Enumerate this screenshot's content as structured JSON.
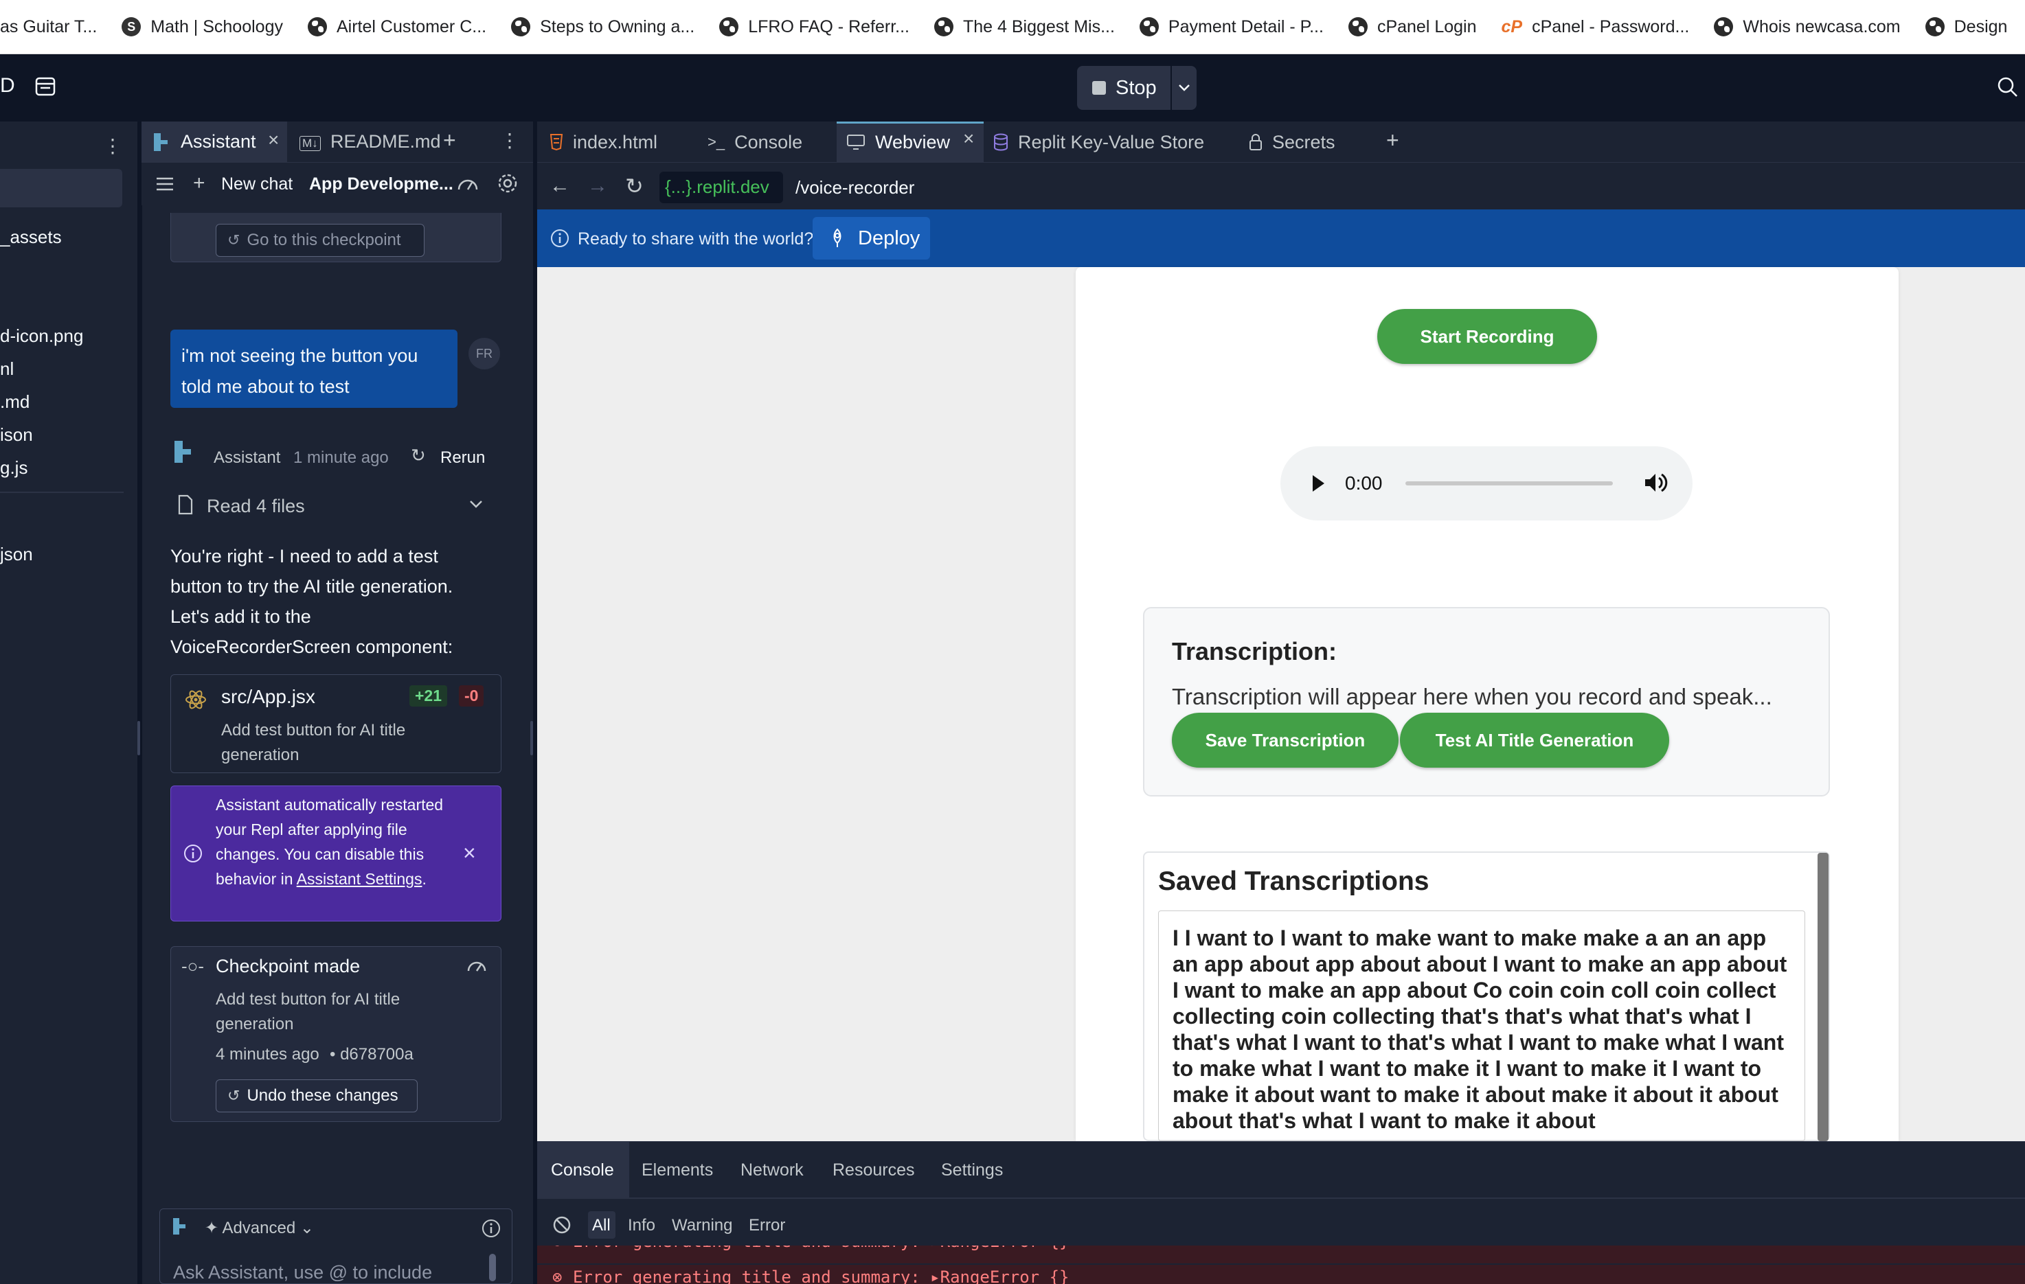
{
  "bookmarks": [
    {
      "label": "as Guitar T...",
      "icon": "globe-icon"
    },
    {
      "label": "Math | Schoology",
      "icon": "schoology-icon"
    },
    {
      "label": "Airtel Customer C...",
      "icon": "globe-icon"
    },
    {
      "label": "Steps to Owning a...",
      "icon": "globe-icon"
    },
    {
      "label": "LFRO FAQ - Referr...",
      "icon": "globe-icon"
    },
    {
      "label": "The 4 Biggest Mis...",
      "icon": "globe-icon"
    },
    {
      "label": "Payment Detail - P...",
      "icon": "globe-icon"
    },
    {
      "label": "cPanel Login",
      "icon": "globe-icon"
    },
    {
      "label": "cPanel - Password...",
      "icon": "cpanel-icon"
    },
    {
      "label": "Whois newcasa.com",
      "icon": "globe-icon"
    },
    {
      "label": "Design",
      "icon": "globe-icon"
    }
  ],
  "topbar": {
    "left_label": "D",
    "stop_label": "Stop"
  },
  "files": {
    "items": [
      "_assets",
      "d-icon.png",
      "nl",
      ".md",
      "ison",
      "g.js",
      "json"
    ]
  },
  "assistant_tabs": {
    "assistant": "Assistant",
    "readme": "README.md",
    "md_badge": "M↓"
  },
  "chatbar": {
    "new_chat": "New chat",
    "chat_title": "App Developme..."
  },
  "chat": {
    "checkpoint_top": "Go to this checkpoint",
    "user_avatar": "FR",
    "user_message": "i'm not seeing the button you told me about to test",
    "assistant_name": "Assistant",
    "assistant_time": "1 minute ago",
    "rerun": "Rerun",
    "read_files": "Read 4 files",
    "reply": "You're right - I need to add a test button to try the AI title generation. Let's add it to the VoiceRecorderScreen component:",
    "file_change": {
      "path": "src/App.jsx",
      "added": "+21",
      "removed": "-0",
      "desc": "Add test button for AI title generation"
    },
    "notice": {
      "text": "Assistant automatically restarted your Repl after applying file changes. You can disable this behavior in",
      "link": "Assistant Settings",
      "end": "."
    },
    "checkpoint": {
      "title": "Checkpoint made",
      "desc": "Add test button for AI title generation",
      "time": "4 minutes ago",
      "hash": "• d678700a",
      "undo": "Undo these changes"
    },
    "input": {
      "mode": "Advanced",
      "placeholder": "Ask Assistant, use @ to include"
    }
  },
  "workspace_tabs": [
    {
      "label": "index.html",
      "icon": "html-icon"
    },
    {
      "label": "Console",
      "icon": "terminal-icon"
    },
    {
      "label": "Webview",
      "icon": "monitor-icon",
      "active": true
    },
    {
      "label": "Replit Key-Value Store",
      "icon": "database-icon"
    },
    {
      "label": "Secrets",
      "icon": "lock-icon"
    }
  ],
  "url": {
    "domain": "{...}.replit.dev",
    "path": "/voice-recorder"
  },
  "deploy": {
    "prompt": "Ready to share with the world?",
    "button": "Deploy"
  },
  "app": {
    "start_recording": "Start Recording",
    "audio_time": "0:00",
    "transcription_title": "Transcription:",
    "transcription_placeholder": "Transcription will appear here when you record and speak...",
    "save_button": "Save Transcription",
    "test_button": "Test AI Title Generation",
    "saved_title": "Saved Transcriptions",
    "saved_text": "I I want to I want to make want to make make a an an app an app about app about about I want to make an app about I want to make an app about Co coin coin coll coin collect collecting coin collecting that's that's what that's what I that's what I want to that's what I want to make what I want to make what I want to make it I want to make it I want to make it about want to make it about make it about it about about that's what I want to make it about"
  },
  "devtools": {
    "tabs": [
      "Console",
      "Elements",
      "Network",
      "Resources",
      "Settings"
    ],
    "filters": [
      "All",
      "Info",
      "Warning",
      "Error"
    ],
    "errors": [
      "Error generating title and summary: ▸RangeError {}",
      "Error generating title and summary: ▸RangeError {}"
    ]
  },
  "colors": {
    "accent_green": "#43a047",
    "deploy_blue": "#0f4c9c",
    "notice_purple": "#4b2a9e",
    "bg_dark": "#0e1525",
    "panel": "#1c2333"
  }
}
